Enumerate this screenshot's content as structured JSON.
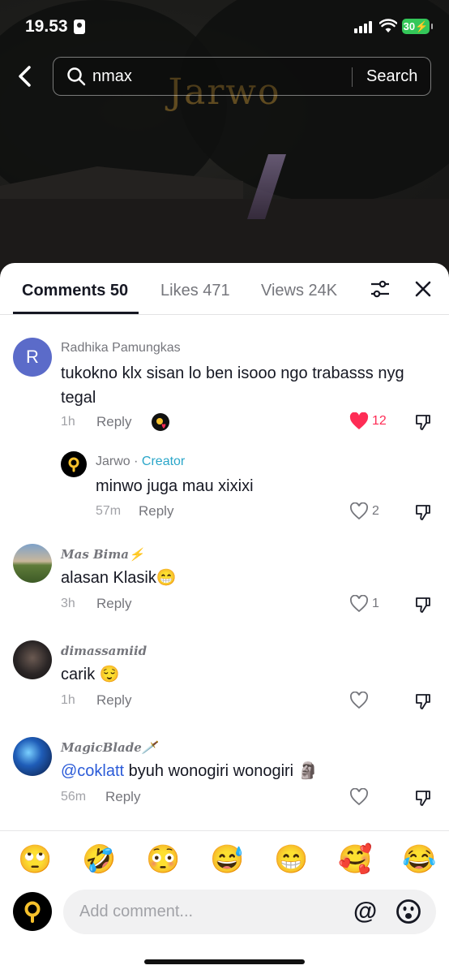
{
  "status_bar": {
    "time": "19.53",
    "battery": "30"
  },
  "video": {
    "watermark": "Jarwo"
  },
  "search": {
    "query": "nmax",
    "button_label": "Search"
  },
  "tabs": [
    {
      "label": "Comments 50"
    },
    {
      "label": "Likes 471"
    },
    {
      "label": "Views 24K"
    }
  ],
  "comments": [
    {
      "initial": "R",
      "name": "Radhika Pamungkas",
      "text": "tukokno klx sisan lo ben isooo ngo trabasss nyg tegal",
      "time": "1h",
      "reply": "Reply",
      "likes": "12",
      "liked": true
    },
    {
      "name": "Jarwo",
      "separator": " · ",
      "badge": "Creator",
      "text": "minwo juga mau xixixi",
      "time": "57m",
      "reply": "Reply",
      "likes": "2"
    },
    {
      "name": "Mas Bima⚡",
      "text": "alasan Klasik😁",
      "time": "3h",
      "reply": "Reply",
      "likes": "1"
    },
    {
      "name": "dimassamiid",
      "text": "carik 😌",
      "time": "1h",
      "reply": "Reply",
      "likes": ""
    },
    {
      "name": "MagicBlade🗡️",
      "mention": "@coklatt",
      "text": " byuh wonogiri wonogiri 🗿",
      "time": "56m",
      "reply": "Reply",
      "likes": ""
    }
  ],
  "emoji_bar": [
    "🙄",
    "🤣",
    "😳",
    "😅",
    "😁",
    "🥰",
    "😂"
  ],
  "composer": {
    "placeholder": "Add comment...",
    "at": "@"
  },
  "colors": {
    "like_red": "#fe2c55",
    "creator_teal": "#2aa6c9",
    "mention_blue": "#2b5bd8",
    "avatar_purple": "#5b6bc9"
  }
}
